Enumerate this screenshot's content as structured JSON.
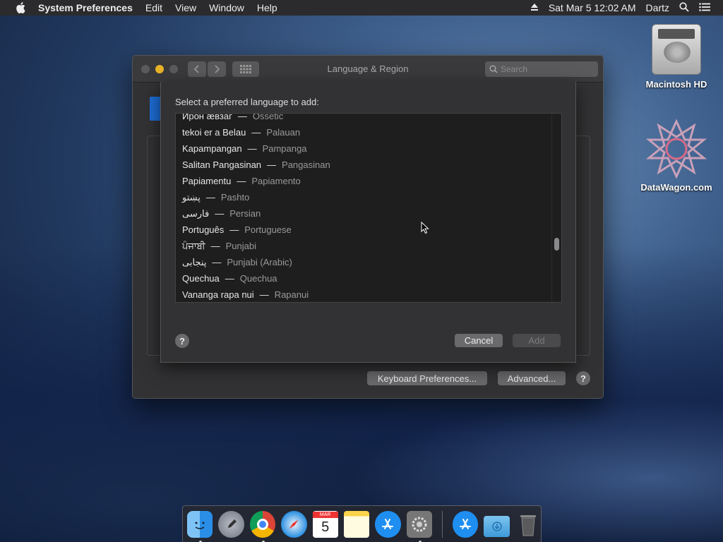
{
  "menubar": {
    "app_name": "System Preferences",
    "items": [
      "Edit",
      "View",
      "Window",
      "Help"
    ],
    "datetime": "Sat Mar 5  12:02 AM",
    "user": "Dartz"
  },
  "desktop": {
    "icons": [
      {
        "label": "Macintosh HD"
      },
      {
        "label": "DataWagon.com"
      }
    ]
  },
  "window": {
    "title": "Language & Region",
    "search_placeholder": "Search",
    "buttons": {
      "keyboard": "Keyboard Preferences...",
      "advanced": "Advanced...",
      "help": "?"
    }
  },
  "sheet": {
    "prompt": "Select a preferred language to add:",
    "languages": [
      {
        "native": "Ирон ӕвзаг",
        "english": "Ossetic"
      },
      {
        "native": "tekoi er a Belau",
        "english": "Palauan"
      },
      {
        "native": "Kapampangan",
        "english": "Pampanga"
      },
      {
        "native": "Salitan Pangasinan",
        "english": "Pangasinan"
      },
      {
        "native": "Papiamentu",
        "english": "Papiamento"
      },
      {
        "native": "پښتو",
        "english": "Pashto"
      },
      {
        "native": "فارسی",
        "english": "Persian"
      },
      {
        "native": "Português",
        "english": "Portuguese"
      },
      {
        "native": "ਪੰਜਾਬੀ",
        "english": "Punjabi"
      },
      {
        "native": "پنجابی",
        "english": "Punjabi (Arabic)"
      },
      {
        "native": "Quechua",
        "english": "Quechua"
      },
      {
        "native": "Vananga rapa nui",
        "english": "Rapanui"
      }
    ],
    "separator": "—",
    "help": "?",
    "cancel_label": "Cancel",
    "add_label": "Add"
  },
  "dock": {
    "items": [
      {
        "icon": "finder-icon",
        "running": true
      },
      {
        "icon": "launchpad-icon",
        "running": false
      },
      {
        "icon": "chrome-icon",
        "running": true
      },
      {
        "icon": "safari-icon",
        "running": false
      },
      {
        "icon": "calendar-icon",
        "running": false,
        "month": "MAR",
        "day": "5"
      },
      {
        "icon": "notes-icon",
        "running": false
      },
      {
        "icon": "app-store-icon",
        "running": false
      },
      {
        "icon": "system-preferences-icon",
        "running": true
      },
      {
        "icon": "app-store-icon-2",
        "running": false
      },
      {
        "icon": "downloads-folder-icon",
        "running": false
      },
      {
        "icon": "trash-icon",
        "running": false
      }
    ]
  },
  "colors": {
    "accent": "#e8b327",
    "window_bg": "#323234",
    "list_bg": "#1e1e1f"
  }
}
